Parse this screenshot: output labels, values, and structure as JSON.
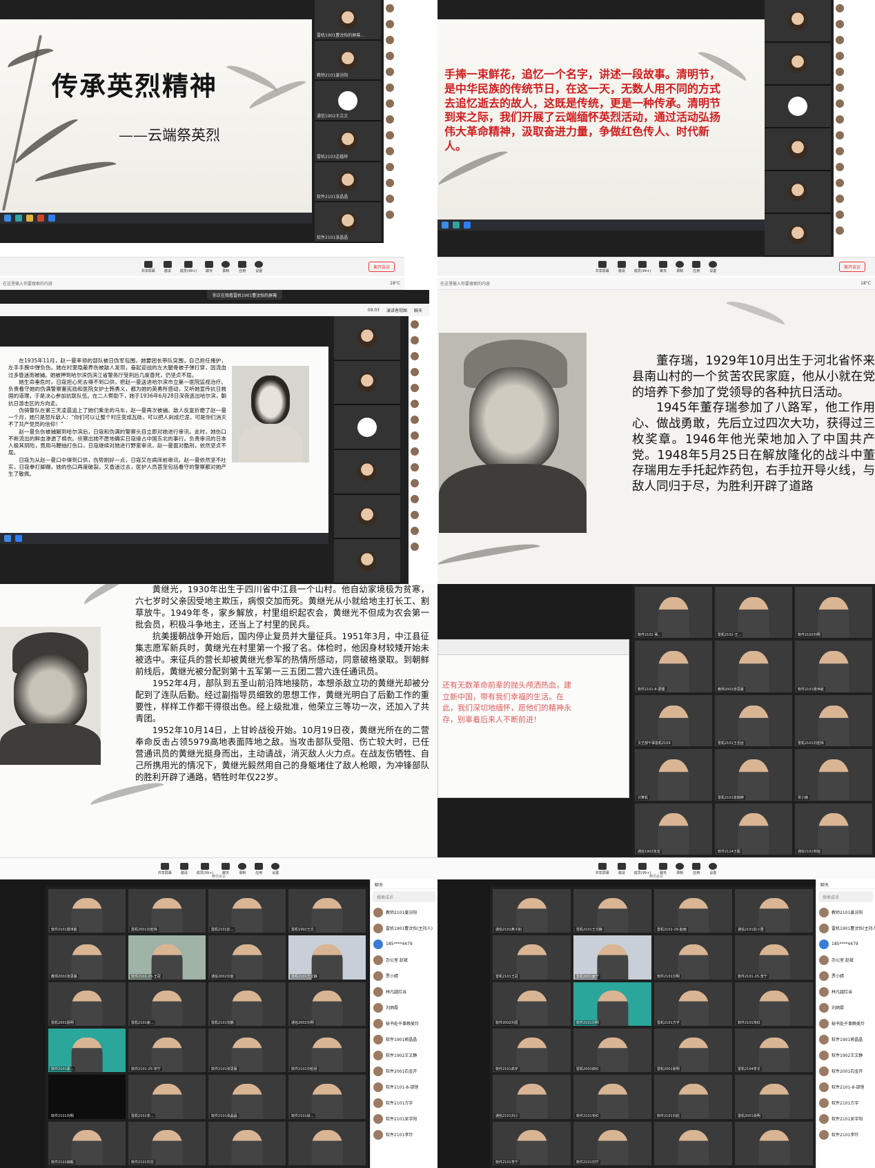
{
  "panel1": {
    "title": "传承英烈精神",
    "subtitle": "——云端祭英烈",
    "rail_names": [
      "雷机1901曹汶怡的屏幕...",
      "教师2101姜汾阳",
      "通信1902王立文",
      "雷机2103孟楷轩",
      "软件2101张晶晶",
      "软件2101张晶晶"
    ]
  },
  "panel2": {
    "text": "手捧一束鲜花，追忆一个名字，讲述一段故事。清明节，是中华民族的传统节日，在这一天，无数人用不同的方式去追忆逝去的故人，这既是传统，更是一种传承。清明节到来之际，我们开展了云端缅怀英烈活动，通过活动弘扬伟大革命精神，汲取奋进力量，争做红色传人、时代新人。"
  },
  "meetbar": {
    "leave": "离开会议",
    "weather": "18°C",
    "search_placeholder": "在这里输入你要搜索的内容",
    "share_tip": "你正在观看雷机1901曹汶怡的屏幕",
    "time": "09:03",
    "view": "演讲者视图",
    "chat": "聊天",
    "meeting_label": "腾讯会议",
    "buttons": [
      "共享屏幕",
      "邀请",
      "成员(99+)",
      "聊天",
      "录制",
      "应用",
      "设置"
    ]
  },
  "panel3": {
    "paragraphs": [
      "在1935年11月，赵一曼率领的部队被日伪军包围，她要团长带队突围，自己担任掩护，左手手腕中弹负伤。她在村里隐蔽养伤被敌人发现，奋起迎战的左大腿骨被子弹打穿，因流血过多昏迷而被捕。她被押到哈尔滨伪滨江省警务厅受刑后几度昏死，仍坚贞不屈。",
      "她生命垂危时，日寇担心死去得不到口供，把赵一曼送进哈尔滨市立第一医院监视治疗。负责看守她的伪满警察董宪勋和医院女护士韩勇义，都为她的英勇所感动，又听她宣传抗日救国的道理，于是决心参加抗联队伍。在二人帮助下，她于1936年6月28日深夜逃出哈尔滨，朝抗日游击区的方向走。",
      "伪骑警队在第三天凌晨追上了她们乘坐的马车，赵一曼再次被捕。敌人反复折磨了赵一曼一个月，她只是怒斥敌人：“你们可以让整个村庄变成瓦砾，可以把人剁成烂泥，可是你们消灭不了共产党员的信仰！”",
      "赵一曼负伤被捕解到哈尔滨后，日寇和伪满的警察头目立即对她进行审讯。此时，她伤口不断流出的鲜血渗透了棉衣。侦察出她不愿地确实日寇侵占中国东北的事行。负责审讯的日本人极其阴险，竟用马鞭抽打伤口，日寇继续对她进行野蛮审讯，赵一曼面对酷刑，依然坚贞不屈。",
      "日寇为从赵一曼口中得到口供，伤势刚好一点，日寇又在病床前审讯，赵一曼依然坚不吐实，日寇拳打脚踢，她的伤口再度破裂。又昏迷过去，医护人员甚至包括看守的警察都对她产生了敬佩。"
    ]
  },
  "panel4": {
    "paragraphs": [
      "董存瑞，1929年10月出生于河北省怀来县南山村的一个贫苦农民家庭，他从小就在党的培养下参加了党领导的各种抗日活动。",
      "1945年董存瑞参加了八路军，他工作用心、做战勇敢，先后立过四次大功，获得过三枚奖章。1946年他光荣地加入了中国共产党。1948年5月25日在解放隆化的战斗中董存瑞用左手托起炸药包，右手拉开导火线，与敌人同归于尽，为胜利开辟了道路"
    ]
  },
  "panel5": {
    "paragraphs": [
      "黄继光，1930年出生于四川省中江县一个山村。他自幼家境极为贫寒，六七岁时父亲因受地主欺压，病恨交加而死。黄继光从小就给地主打长工、割草放牛。1949年冬，家乡解放，村里组织起农会，黄继光不但成为农会第一批会员，积极斗争地主，还当上了村里的民兵。",
      "抗美援朝战争开始后，国内停止复员并大量征兵。1951年3月，中江县征集志愿军新兵时，黄继光在村里第一个报了名。体检时，他因身材较矮开始未被选中。来征兵的营长却被黄继光参军的热情所感动，同意破格录取。到朝鲜前线后，黄继光被分配到第十五军第一三五团二营六连任通讯员。",
      "1952年4月，部队到五圣山前沿阵地接防，本想杀敌立功的黄继光却被分配到了连队后勤。经过副指导员细致的思想工作，黄继光明白了后勤工作的重要性，样样工作都干得很出色。经上级批准，他荣立三等功一次，还加入了共青团。",
      "1952年10月14日，上甘岭战役开始。10月19日夜，黄继光所在的二营奉命反击占领5979高地表面阵地之敌。当攻击部队受阻、伤亡较大时，已任营通讯员的黄继光挺身而出，主动请战，消灭敌人火力点。在战友伤牺牲、自己所携用光的情况下，黄继光毅然用自己的身躯堵住了敌人枪眼，为冲锋部队的胜利开辟了通路，牺牲时年仅22岁。"
    ]
  },
  "panel6": {
    "text": "还有无数革命前辈的抛头颅洒热血，建立新中国，带有我们幸福的生活。在此，我们深切地缅怀，愿他们的精神永存，别辜着后来人不断前进！",
    "names": [
      "软件2102-吴..",
      "雷机2102-王...",
      "软件2102刘明",
      "软件2101-8-邵镗",
      "教师2002张思晨",
      "软件2101聂世航",
      "文艺部干事雷机2103",
      "雷机2101王志远",
      "雷机2101刘宏炜",
      "计算机",
      "雷机2101张婉婷",
      "贾小婧",
      "通信1902张龙",
      "软件2124王聪",
      "通信2101林旭"
    ]
  },
  "panel7": {
    "names": [
      "软件2101聂世航",
      "雷机2001刘宏炜",
      "雷机2101彭...",
      "雷机1902王文",
      "教师2002张思晨",
      "软件2102-25-王冠",
      "通信2002刘亚",
      "雷机2101王文静",
      "雷机2001聂明",
      "雷机2101姜...",
      "雷机2101张鹏",
      "通信2002刘明",
      "软件2101夏...",
      "软件2101-25-宋宁",
      "软件2101张思晨",
      "软件2101刘伯昆",
      "软件2101刘明",
      "雷机2101李...",
      "软件2101张晶晶",
      "软件2101徐...",
      "软件2101姚毅",
      "软件2101刘文"
    ],
    "chat_title": "聊天",
    "chat_search": "搜索成员",
    "chat_members": [
      "教师2101姜汾阳",
      "雷机1901曹汶怡(主持人)",
      "185****4479",
      "办公室 赵斌",
      "贾小婧",
      "林凡越红当",
      "刘炳霞",
      "秘书处干事赖美玲",
      "软件1901郭晶晶",
      "软件1902王文静",
      "软件2001石金开",
      "软件2101-8-邵镗",
      "软件2101方宇",
      "软件2101吴宇阳",
      "软件2101李玲"
    ]
  },
  "panel8": {
    "names": [
      "通信2101黄子如",
      "雷机2101王文静",
      "雷机2102-29-赵雨",
      "通信2101彭小雪",
      "雷机2101王冠",
      "雷机2001姜宁",
      "软件2101刘明",
      "软件2101-25-李宁",
      "软件2002刘思",
      "软件2101刘明",
      "雷机2101方宇",
      "软件2101宋红",
      "软件2101高宇",
      "雷机2002徐红",
      "雷机2001聂明",
      "雷机2104李文",
      "通信2101刘小",
      "软件2101宋红",
      "软件2101刘伯",
      "雷机2001张明",
      "软件2101李宁",
      "软件2101刘宁"
    ],
    "chat_members": [
      "教师2101姜汾阳",
      "雷机1901曹汶怡(主持人)",
      "185****4479",
      "办公室 赵斌",
      "贾小婧",
      "林凡越红当",
      "刘炳霞",
      "秘书处干事赖美玲",
      "软件1901郭晶晶",
      "软件1902王文静",
      "软件2001石金开",
      "软件2101-8-邵镗",
      "软件2101方宇",
      "软件2101吴宇阳",
      "软件2101李玲"
    ]
  }
}
